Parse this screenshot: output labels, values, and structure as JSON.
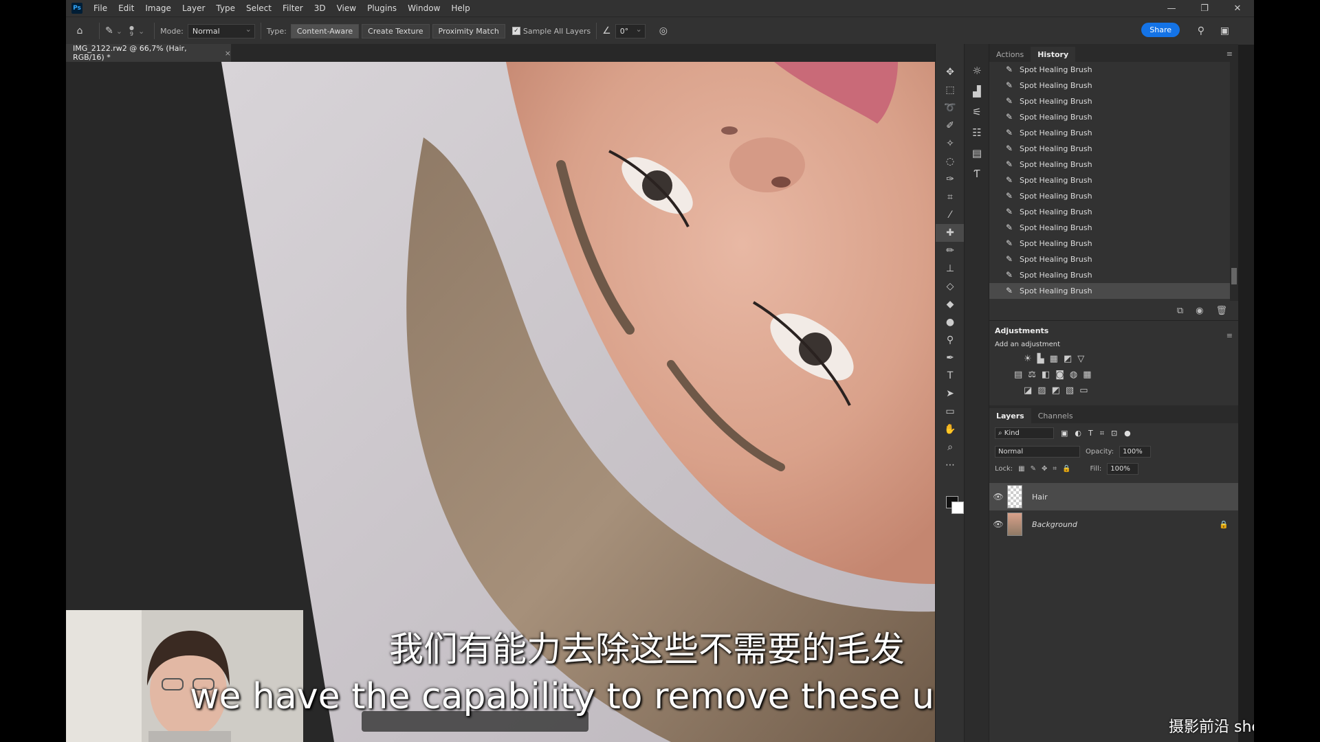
{
  "app": {
    "logo": "Ps"
  },
  "menu": [
    "File",
    "Edit",
    "Image",
    "Layer",
    "Type",
    "Select",
    "Filter",
    "3D",
    "View",
    "Plugins",
    "Window",
    "Help"
  ],
  "options": {
    "brush_size": "9",
    "mode_label": "Mode:",
    "mode_value": "Normal",
    "type_label": "Type:",
    "type_buttons": [
      "Content-Aware",
      "Create Texture",
      "Proximity Match"
    ],
    "sample_all_layers": "Sample All Layers",
    "angle_value": "0°",
    "share_label": "Share"
  },
  "document_tab": {
    "title": "IMG_2122.rw2 @ 66,7% (Hair, RGB/16) *",
    "close": "×"
  },
  "history_panel": {
    "tabs": [
      "Actions",
      "History"
    ],
    "items": [
      "Spot Healing Brush",
      "Spot Healing Brush",
      "Spot Healing Brush",
      "Spot Healing Brush",
      "Spot Healing Brush",
      "Spot Healing Brush",
      "Spot Healing Brush",
      "Spot Healing Brush",
      "Spot Healing Brush",
      "Spot Healing Brush",
      "Spot Healing Brush",
      "Spot Healing Brush",
      "Spot Healing Brush",
      "Spot Healing Brush",
      "Spot Healing Brush"
    ]
  },
  "adjustments_panel": {
    "title": "Adjustments",
    "subtitle": "Add an adjustment"
  },
  "layers_panel": {
    "tabs": [
      "Layers",
      "Channels"
    ],
    "kind_label": "Kind",
    "blend_mode": "Normal",
    "opacity_label": "Opacity:",
    "opacity_value": "100%",
    "lock_label": "Lock:",
    "fill_label": "Fill:",
    "fill_value": "100%",
    "layers": [
      {
        "name": "Hair",
        "selected": true,
        "visible": true
      },
      {
        "name": "Background",
        "selected": false,
        "visible": true,
        "locked": true
      }
    ]
  },
  "subtitles": {
    "chinese": "我们有能力去除这些不需要的毛发",
    "english": "we have the capability to remove these unwanted hairs"
  },
  "watermark": "摄影前沿 sheyingzyz.com",
  "colors": {
    "accent": "#1473e6",
    "panel_bg": "#323232",
    "canvas_bg": "#282828"
  }
}
